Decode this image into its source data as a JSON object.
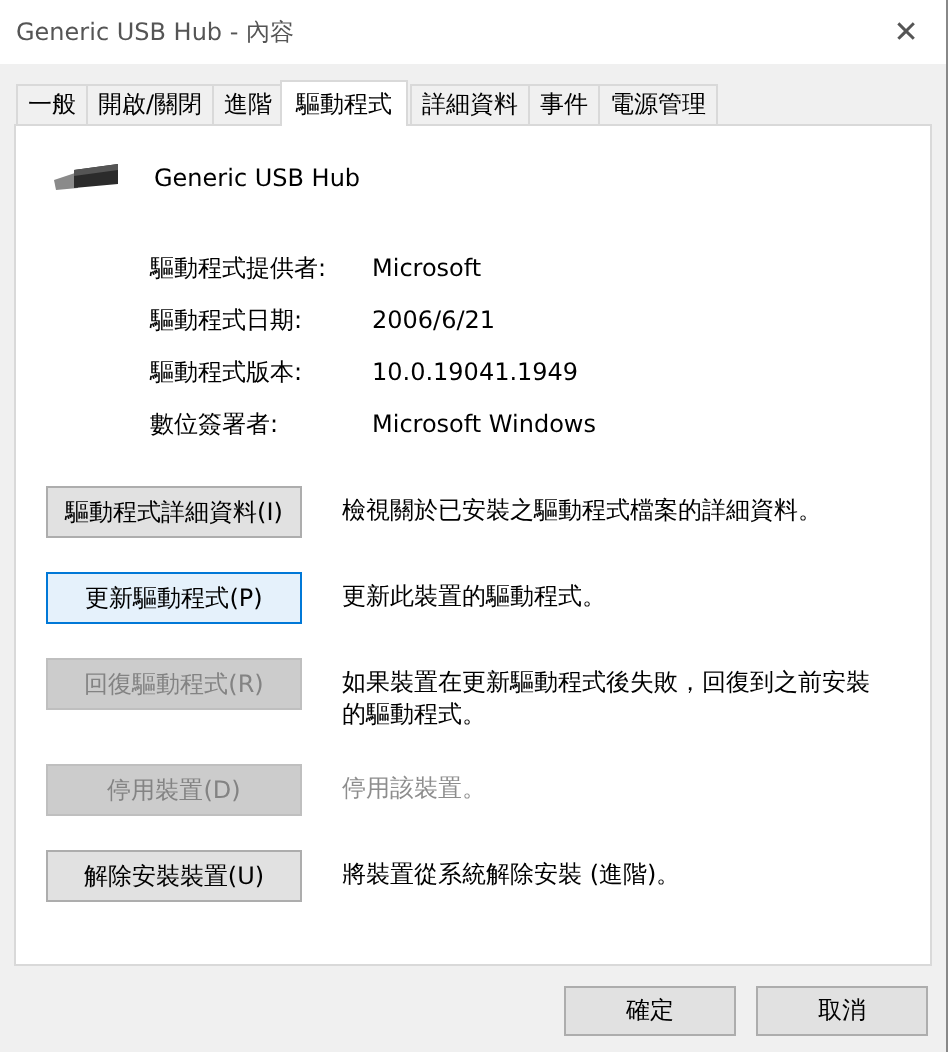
{
  "window": {
    "title": "Generic USB Hub - 內容",
    "close": "✕"
  },
  "tabs": [
    {
      "label": "一般",
      "selected": false
    },
    {
      "label": "開啟/關閉",
      "selected": false
    },
    {
      "label": "進階",
      "selected": false
    },
    {
      "label": "驅動程式",
      "selected": true
    },
    {
      "label": "詳細資料",
      "selected": false
    },
    {
      "label": "事件",
      "selected": false
    },
    {
      "label": "電源管理",
      "selected": false
    }
  ],
  "device": {
    "name": "Generic USB Hub"
  },
  "properties": [
    {
      "label": "驅動程式提供者:",
      "value": "Microsoft"
    },
    {
      "label": "驅動程式日期:",
      "value": "2006/6/21"
    },
    {
      "label": "驅動程式版本:",
      "value": "10.0.19041.1949"
    },
    {
      "label": "數位簽署者:",
      "value": "Microsoft Windows"
    }
  ],
  "actions": [
    {
      "button": "驅動程式詳細資料(I)",
      "description": "檢視關於已安裝之驅動程式檔案的詳細資料。",
      "disabled": false,
      "focused": false,
      "description_disabled": false
    },
    {
      "button": "更新驅動程式(P)",
      "description": "更新此裝置的驅動程式。",
      "disabled": false,
      "focused": true,
      "description_disabled": false
    },
    {
      "button": "回復驅動程式(R)",
      "description": "如果裝置在更新驅動程式後失敗，回復到之前安裝的驅動程式。",
      "disabled": true,
      "focused": false,
      "description_disabled": false
    },
    {
      "button": "停用裝置(D)",
      "description": "停用該裝置。",
      "disabled": true,
      "focused": false,
      "description_disabled": true
    },
    {
      "button": "解除安裝裝置(U)",
      "description": "將裝置從系統解除安裝 (進階)。",
      "disabled": false,
      "focused": false,
      "description_disabled": false
    }
  ],
  "buttons": [
    "確定",
    "取消"
  ]
}
